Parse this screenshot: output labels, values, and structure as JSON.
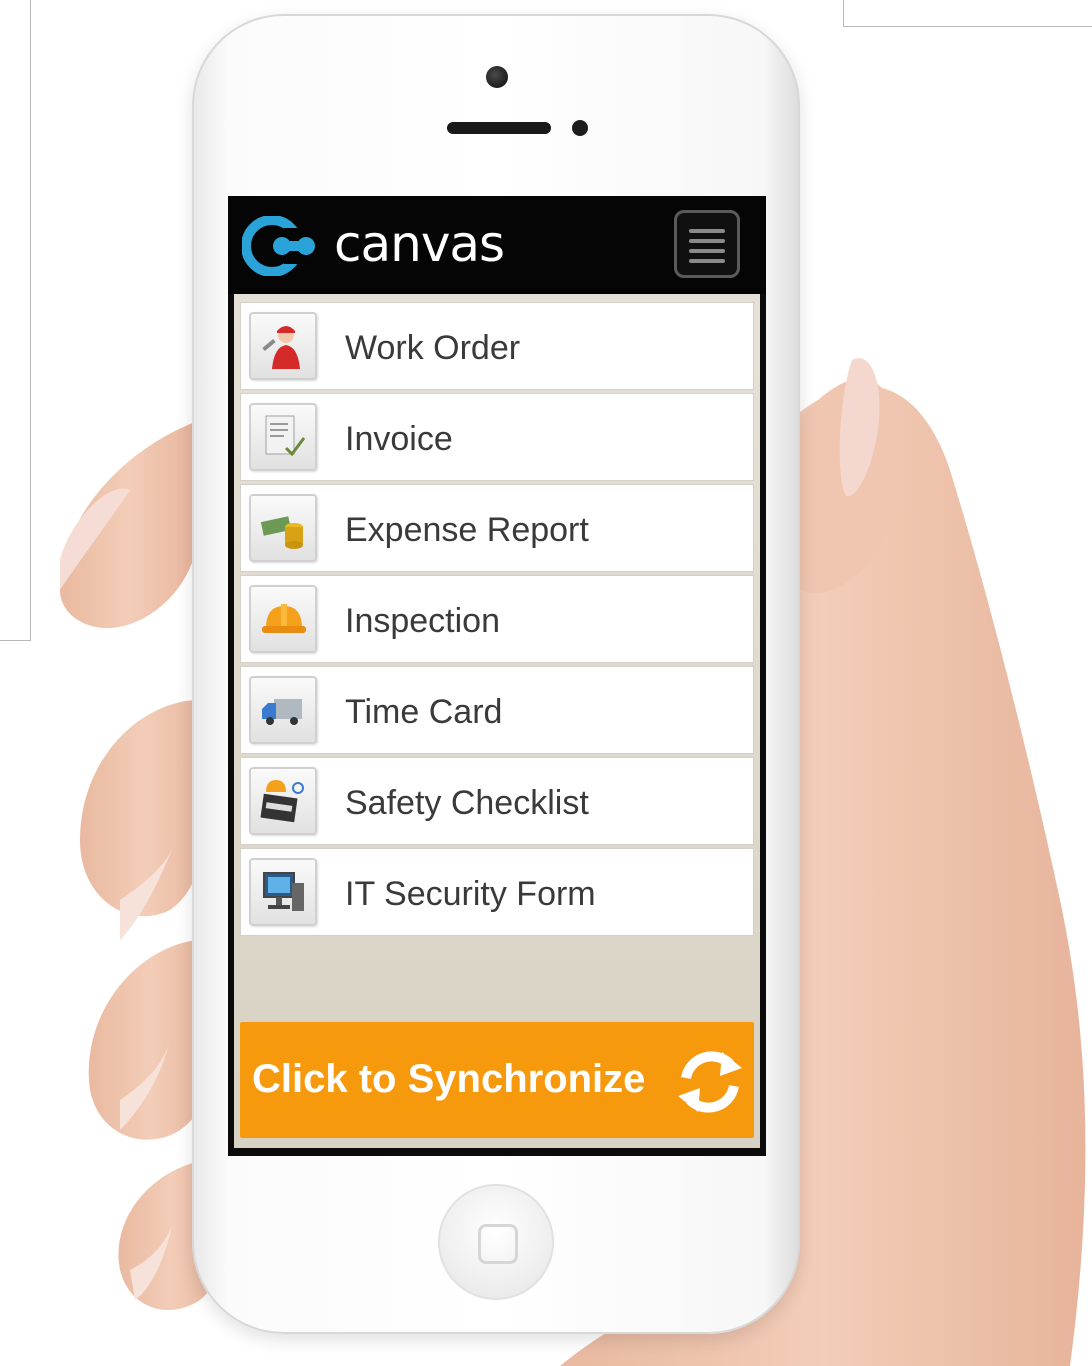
{
  "app": {
    "logo_text": "canvas",
    "brand_color": "#2aa3d8",
    "menu_icon": "hamburger-menu-icon"
  },
  "menu": {
    "items": [
      {
        "label": "Work Order",
        "icon": "worker-icon"
      },
      {
        "label": "Invoice",
        "icon": "document-check-icon"
      },
      {
        "label": "Expense Report",
        "icon": "money-coins-icon"
      },
      {
        "label": "Inspection",
        "icon": "hard-hat-icon"
      },
      {
        "label": "Time Card",
        "icon": "truck-icon"
      },
      {
        "label": "Safety Checklist",
        "icon": "safety-sign-icon"
      },
      {
        "label": "IT Security Form",
        "icon": "computer-icon"
      }
    ]
  },
  "sync": {
    "label": "Click to Synchronize",
    "icon": "refresh-icon",
    "color": "#f7990d"
  }
}
